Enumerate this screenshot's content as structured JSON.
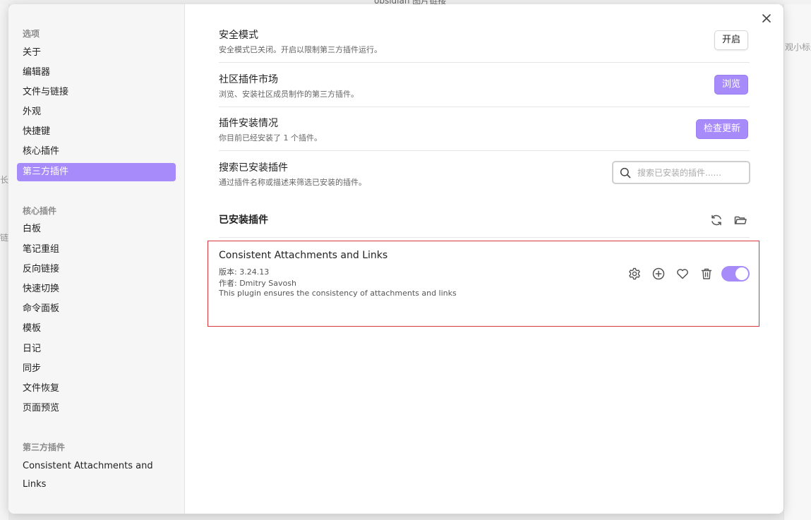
{
  "background": {
    "title": "obsidian 图片链接",
    "right_hint": "观小标题",
    "left_hint_1": "长",
    "left_hint_2": "链"
  },
  "sidebar": {
    "options_group": "选项",
    "options_items": [
      "关于",
      "编辑器",
      "文件与链接",
      "外观",
      "快捷键",
      "核心插件",
      "第三方插件"
    ],
    "core_group": "核心插件",
    "core_items": [
      "白板",
      "笔记重组",
      "反向链接",
      "快速切换",
      "命令面板",
      "模板",
      "日记",
      "同步",
      "文件恢复",
      "页面预览"
    ],
    "third_group": "第三方插件",
    "third_items": [
      "Consistent Attachments and Links"
    ]
  },
  "settings": {
    "safe_mode": {
      "name": "安全模式",
      "desc": "安全模式已关闭。开启以限制第三方插件运行。",
      "button": "开启"
    },
    "community": {
      "name": "社区插件市场",
      "desc": "浏览、安装社区成员制作的第三方插件。",
      "button": "浏览"
    },
    "installed_status": {
      "name": "插件安装情况",
      "desc": "你目前已经安装了 1 个插件。",
      "button": "检查更新"
    },
    "search": {
      "name": "搜索已安装插件",
      "desc": "通过插件名称或描述来筛选已安装的插件。",
      "placeholder": "搜索已安装的插件......",
      "value": ""
    }
  },
  "installed": {
    "heading": "已安装插件",
    "plugin": {
      "name": "Consistent Attachments and Links",
      "version": "版本: 3.24.13",
      "author": "作者: Dmitry Savosh",
      "description": "This plugin ensures the consistency of attachments and links",
      "enabled": true
    }
  },
  "colors": {
    "accent": "#a88bfa",
    "highlight_border": "#d9373d"
  },
  "icons": {
    "close": "close-icon",
    "search": "search-icon",
    "reload": "reload-icon",
    "folder": "folder-icon",
    "settings": "gear-icon",
    "hotkey": "plus-circle-icon",
    "favorite": "heart-icon",
    "uninstall": "trash-icon"
  }
}
